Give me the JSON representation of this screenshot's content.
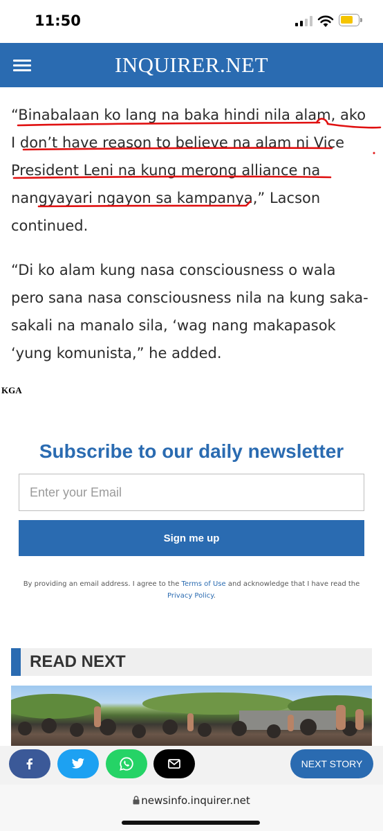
{
  "status_bar": {
    "time": "11:50"
  },
  "header": {
    "site_name": "INQUIRER.NET"
  },
  "article": {
    "paragraphs": [
      "“Binabalaan ko lang na baka hindi nila alam, ako I don’t have reason to believe na alam ni Vice President Leni na kung merong alliance na nangyayari ngayon sa kampanya,” Lacson continued.",
      "“Di ko alam kung nasa consciousness o wala pero sana nasa consciousness nila na kung saka-sakali na manalo sila, ‘wag nang makapasok ‘yung komunista,” he added."
    ],
    "byline": "KGA"
  },
  "newsletter": {
    "title": "Subscribe to our daily newsletter",
    "email_placeholder": "Enter your Email",
    "signup_label": "Sign me up",
    "disclaimer_pre": "By providing an email address. I agree to the ",
    "terms_link": "Terms of Use",
    "disclaimer_mid": " and acknowledge that I have read the ",
    "privacy_link": "Privacy Policy",
    "disclaimer_post": "."
  },
  "read_next": {
    "heading": "READ NEXT"
  },
  "share_bar": {
    "buttons": [
      {
        "icon": "facebook-icon",
        "color": "#3b5998"
      },
      {
        "icon": "twitter-icon",
        "color": "#1da1f2"
      },
      {
        "icon": "whatsapp-icon",
        "color": "#25d366"
      },
      {
        "icon": "mail-icon",
        "color": "#000000"
      }
    ],
    "next_story_label": "NEXT STORY"
  },
  "browser": {
    "url": "newsinfo.inquirer.net"
  },
  "colors": {
    "brand_blue": "#2a6bb1",
    "annotation_red": "#e01010"
  }
}
